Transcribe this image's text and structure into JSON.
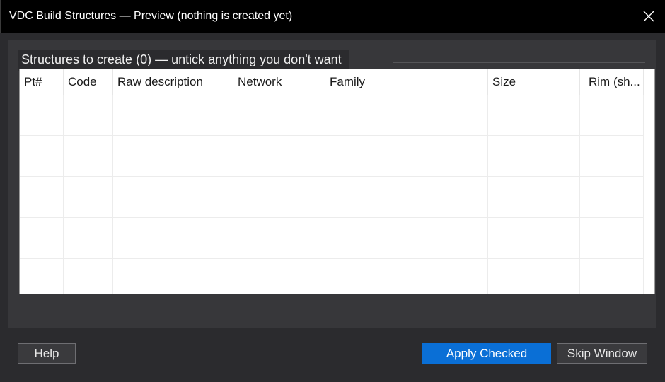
{
  "window": {
    "title": "VDC Build Structures — Preview (nothing is created yet)"
  },
  "group": {
    "title": "Structures to create (0) — untick anything you don't want"
  },
  "table": {
    "columns": [
      "Pt#",
      "Code",
      "Raw description",
      "Network",
      "Family",
      "Size",
      "Rim (sh..."
    ],
    "rows": []
  },
  "buttons": {
    "help": "Help",
    "apply": "Apply Checked",
    "skip": "Skip Window"
  },
  "colors": {
    "titlebar": "#000000",
    "background": "#2b2b2e",
    "accent": "#0a6fd6"
  },
  "icons": {
    "close": "close-icon"
  }
}
